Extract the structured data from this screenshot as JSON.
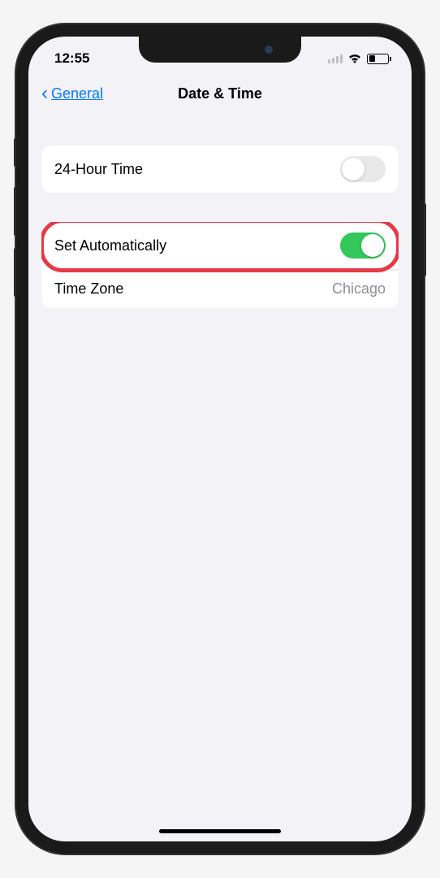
{
  "status": {
    "time": "12:55"
  },
  "nav": {
    "back_label": "General",
    "title": "Date & Time"
  },
  "section1": {
    "row24hour": {
      "label": "24-Hour Time",
      "enabled": false
    }
  },
  "section2": {
    "rowAuto": {
      "label": "Set Automatically",
      "enabled": true,
      "highlighted": true
    },
    "rowTimezone": {
      "label": "Time Zone",
      "value": "Chicago"
    }
  }
}
